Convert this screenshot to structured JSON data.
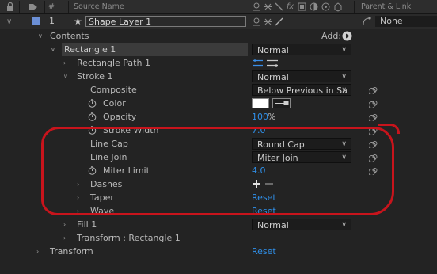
{
  "header": {
    "hash": "#",
    "source_name": "Source Name",
    "fx": "fx",
    "parent_link": "Parent & Link"
  },
  "layer": {
    "number": "1",
    "name": "Shape Layer 1",
    "parent": "None",
    "label_color": "#6b8fd6"
  },
  "contents": {
    "label": "Contents",
    "add_label": "Add:"
  },
  "rectangle1": {
    "label": "Rectangle 1",
    "blend_mode": "Normal"
  },
  "rect_path": {
    "label": "Rectangle Path 1"
  },
  "stroke": {
    "label": "Stroke 1",
    "blend_mode": "Normal",
    "composite_label": "Composite",
    "composite_value": "Below Previous in Sa",
    "color_label": "Color",
    "color_value": "#ffffff",
    "opacity_label": "Opacity",
    "opacity_value": "100",
    "opacity_unit": "%",
    "width_label": "Stroke Width",
    "width_value": "7.0",
    "linecap_label": "Line Cap",
    "linecap_value": "Round Cap",
    "linejoin_label": "Line Join",
    "linejoin_value": "Miter Join",
    "miter_label": "Miter Limit",
    "miter_value": "4.0",
    "dashes_label": "Dashes",
    "taper_label": "Taper",
    "taper_value": "Reset",
    "wave_label": "Wave",
    "wave_value": "Reset"
  },
  "fill": {
    "label": "Fill 1",
    "blend_mode": "Normal"
  },
  "transform_rect": {
    "label": "Transform : Rectangle 1"
  },
  "transform": {
    "label": "Transform",
    "value": "Reset"
  },
  "annotation_color": "#c8141c"
}
